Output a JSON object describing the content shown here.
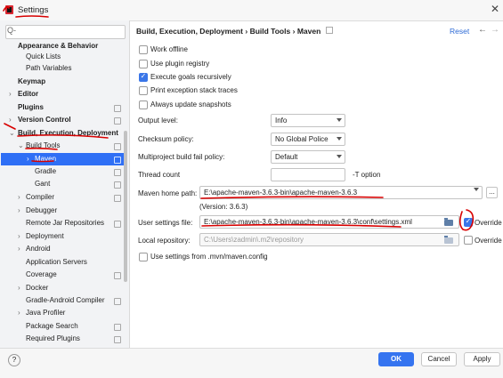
{
  "window": {
    "title": "Settings"
  },
  "sidebar": {
    "search_placeholder": "Q-",
    "items": [
      {
        "label": "Appearance & Behavior"
      },
      {
        "label": "Quick Lists"
      },
      {
        "label": "Path Variables"
      },
      {
        "label": "Keymap"
      },
      {
        "label": "Editor"
      },
      {
        "label": "Plugins"
      },
      {
        "label": "Version Control"
      },
      {
        "label": "Build, Execution, Deployment"
      },
      {
        "label": "Build Tools"
      },
      {
        "label": "Maven"
      },
      {
        "label": "Gradle"
      },
      {
        "label": "Gant"
      },
      {
        "label": "Compiler"
      },
      {
        "label": "Debugger"
      },
      {
        "label": "Remote Jar Repositories"
      },
      {
        "label": "Deployment"
      },
      {
        "label": "Android"
      },
      {
        "label": "Application Servers"
      },
      {
        "label": "Coverage"
      },
      {
        "label": "Docker"
      },
      {
        "label": "Gradle-Android Compiler"
      },
      {
        "label": "Java Profiler"
      },
      {
        "label": "Package Search"
      },
      {
        "label": "Required Plugins"
      }
    ]
  },
  "header": {
    "breadcrumb": [
      "Build, Execution, Deployment",
      "Build Tools",
      "Maven"
    ],
    "separator": "›",
    "reset": "Reset"
  },
  "checkboxes": [
    {
      "label": "Work offline",
      "checked": false
    },
    {
      "label": "Use plugin registry",
      "checked": false
    },
    {
      "label": "Execute goals recursively",
      "checked": true
    },
    {
      "label": "Print exception stack traces",
      "checked": false
    },
    {
      "label": "Always update snapshots",
      "checked": false
    }
  ],
  "fields": {
    "output_level": {
      "label": "Output level:",
      "value": "Info"
    },
    "checksum_policy": {
      "label": "Checksum policy:",
      "value": "No Global Police"
    },
    "fail_policy": {
      "label": "Multiproject build fail policy:",
      "value": "Default"
    },
    "thread_count": {
      "label": "Thread count",
      "value": "",
      "suffix": "-T option"
    },
    "maven_home": {
      "label": "Maven home path:",
      "value": "E:\\apache-maven-3.6.3-bin\\apache-maven-3.6.3",
      "version": "(Version: 3.6.3)",
      "browse": "..."
    },
    "user_settings": {
      "label": "User settings file:",
      "value": "E:\\apache-maven-3.6.3-bin\\apache-maven-3.6.3\\conf\\settings.xml",
      "override_label": "Override",
      "override_checked": true
    },
    "local_repo": {
      "label": "Local repository:",
      "value": "C:\\Users\\zadmin\\.m2\\repository",
      "override_label": "Override",
      "override_checked": false
    },
    "use_mvn_config": {
      "label": "Use settings from .mvn/maven.config",
      "checked": false
    }
  },
  "footer": {
    "help": "?",
    "ok": "OK",
    "cancel": "Cancel",
    "apply": "Apply"
  },
  "colors": {
    "accent": "#3574f0",
    "selection": "#2f6ff5",
    "annotation": "#d80000"
  }
}
